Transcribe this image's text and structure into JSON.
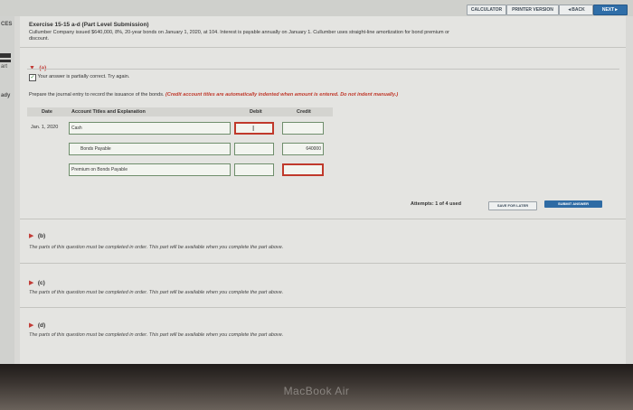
{
  "toolbar": {
    "calculator": "CALCULATOR",
    "printer": "PRINTER VERSION",
    "back": "◄BACK",
    "next": "NEXT►"
  },
  "left_strip": {
    "top": "CES",
    "mid1": "art",
    "mid2": "ady"
  },
  "exercise": {
    "title": "Exercise 15-15 a-d (Part Level Submission)",
    "desc_line1": "Cullumber Company issued $640,000, 8%, 20-year bonds on January 1, 2020, at 104. Interest is payable annually on January 1. Cullumber uses straight-line amortization for bond premium or",
    "desc_line2": "discount."
  },
  "part_a": {
    "label": "(a)",
    "status": "Your answer is partially correct.  Try again.",
    "instruction": "Prepare the journal entry to record the issuance of the bonds.",
    "instruction_red": "(Credit account titles are automatically indented when amount is entered. Do not indent manually.)"
  },
  "journal": {
    "col_date": "Date",
    "col_account": "Account Titles and Explanation",
    "col_debit": "Debit",
    "col_credit": "Credit",
    "rows": [
      {
        "date": "Jan. 1, 2020",
        "account": "Cash",
        "debit": "",
        "credit": ""
      },
      {
        "date": "",
        "account": "Bonds Payable",
        "debit": "",
        "credit": "640000"
      },
      {
        "date": "",
        "account": "Premium on Bonds Payable",
        "debit": "",
        "credit": ""
      }
    ]
  },
  "attempts": {
    "text": "Attempts: 1 of 4 used",
    "save_later": "SAVE FOR LATER",
    "submit": "SUBMIT ANSWER"
  },
  "parts": [
    {
      "label": "(b)",
      "note": "The parts of this question must be completed in order. This part will be available when you complete the part above."
    },
    {
      "label": "(c)",
      "note": "The parts of this question must be completed in order. This part will be available when you complete the part above."
    },
    {
      "label": "(d)",
      "note": "The parts of this question must be completed in order. This part will be available when you complete the part above."
    }
  ],
  "device": {
    "brand": "MacBook Air"
  }
}
